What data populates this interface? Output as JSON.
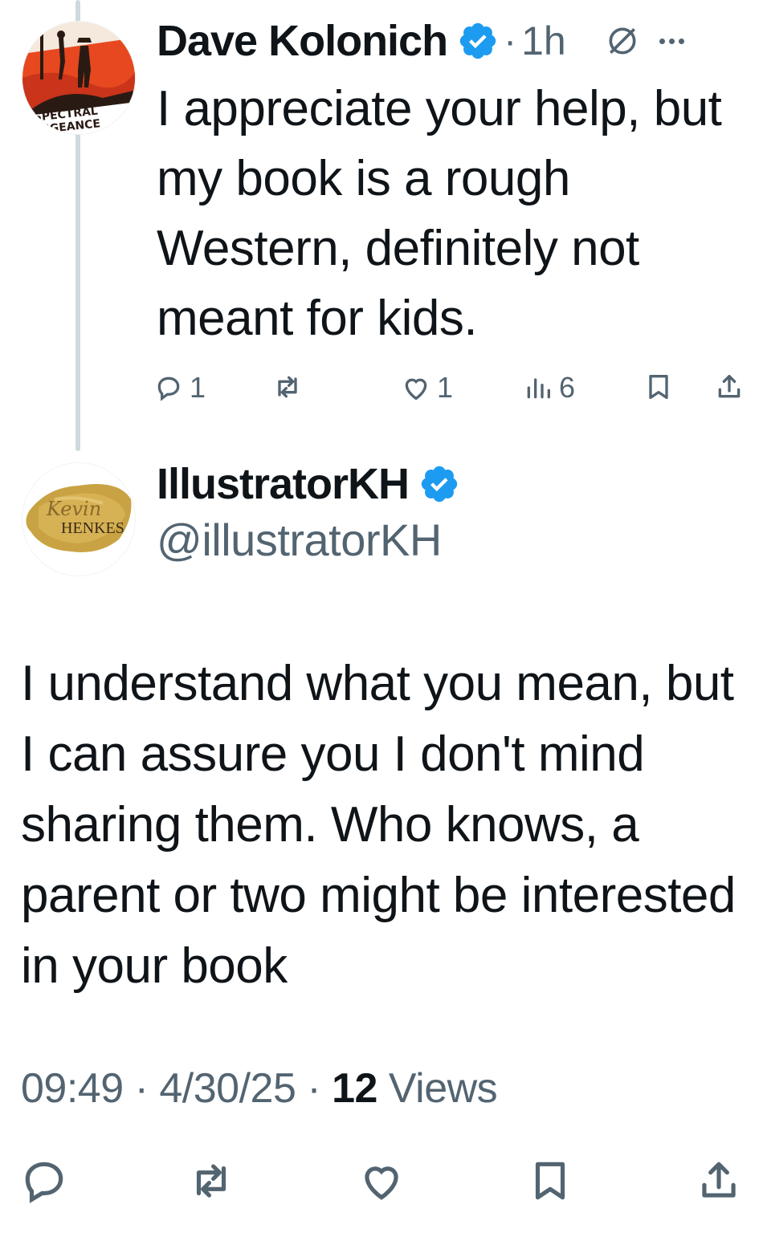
{
  "reply_parent": {
    "display_name": "Dave Kolonich",
    "verified": true,
    "separator": "·",
    "time": "1h",
    "avatar_text": {
      "line1": "SPECTRAL",
      "line2": "VENGEANCE"
    },
    "text": "I appreciate your help, but my book is a rough Western, definitely not meant for kids.",
    "stats": {
      "replies": "1",
      "reposts": "",
      "likes": "1",
      "views": "6"
    }
  },
  "focused_tweet": {
    "display_name": "IllustratorKH",
    "handle": "@illustratorKH",
    "verified": true,
    "avatar_text": {
      "script": "Kevin",
      "name": "HENKES"
    },
    "text": "I understand what you mean, but I can assure you I don't mind sharing them. Who knows, a parent or two might be interested in your book",
    "timestamp": "09:49",
    "date": "4/30/25",
    "separator": "·",
    "views_count": "12",
    "views_label": "Views"
  },
  "colors": {
    "text": "#0f1419",
    "secondary": "#536471",
    "verified": "#1d9bf0",
    "thread_line": "#cfd9de"
  }
}
